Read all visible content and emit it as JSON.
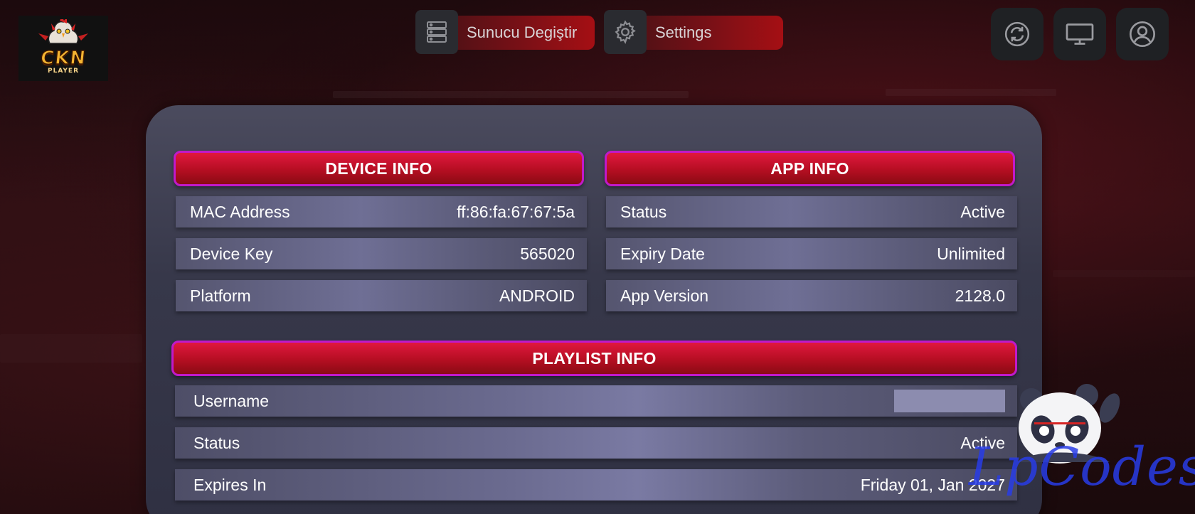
{
  "app": {
    "logo_text": "CKN",
    "logo_subtext": "PLAYER"
  },
  "top_nav": {
    "change_server_label": "Sunucu Degiştir",
    "settings_label": "Settings",
    "icons": [
      "server-list-icon",
      "gear-icon",
      "refresh-icon",
      "monitor-icon",
      "user-icon"
    ]
  },
  "device_info": {
    "title": "DEVICE INFO",
    "rows": [
      {
        "label": "MAC Address",
        "value": "ff:86:fa:67:67:5a"
      },
      {
        "label": "Device Key",
        "value": "565020"
      },
      {
        "label": "Platform",
        "value": "ANDROID"
      }
    ]
  },
  "app_info": {
    "title": "APP INFO",
    "rows": [
      {
        "label": "Status",
        "value": "Active"
      },
      {
        "label": "Expiry Date",
        "value": "Unlimited"
      },
      {
        "label": "App Version",
        "value": "2128.0"
      }
    ]
  },
  "playlist_info": {
    "title": "PLAYLIST INFO",
    "rows": [
      {
        "label": "Username",
        "value": ""
      },
      {
        "label": "Status",
        "value": "Active"
      },
      {
        "label": "Expires In",
        "value": "Friday 01, Jan 2027"
      }
    ]
  },
  "watermark": {
    "text": "LpCodes"
  },
  "colors": {
    "accent_red": "#c0112a",
    "accent_border": "#c119c9",
    "panel": "#3d3e52",
    "row": "#6a6a8e",
    "watermark_blue": "#2838e6"
  }
}
